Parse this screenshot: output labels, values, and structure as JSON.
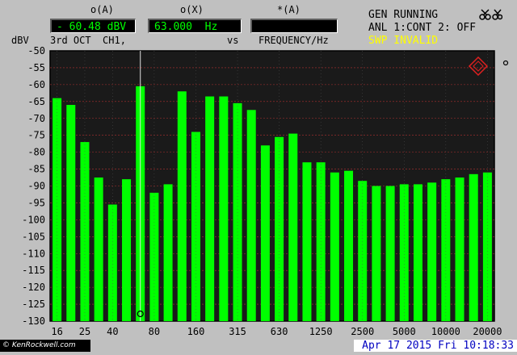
{
  "header": {
    "ch1_label": "o(A)",
    "ch1_value": "- 60.48 dBV",
    "ch2_label": "o(X)",
    "ch2_value": "63.000  Hz",
    "ch3_label": "*(A)",
    "ch3_value": ""
  },
  "left_info": {
    "y_unit": "dBV",
    "trace": "3rd OCT  CH1,",
    "vs": "vs",
    "x_unit": "FREQUENCY/Hz"
  },
  "status": {
    "line1": "GEN RUNNING",
    "line2": "ANL 1:CONT 2: OFF",
    "line3": "SWP INVALID",
    "line3_color": "#ffff00"
  },
  "icons": {
    "top_right": "scissors-icon",
    "brand": "rs-diamond-logo",
    "marker": "marker-circle",
    "scroll": "scroll-dot"
  },
  "footer": {
    "watermark": "© KenRockwell.com",
    "datetime": "Apr 17 2015 Fri 10:18:33"
  },
  "colors": {
    "plot_bg": "#1a1a1a",
    "bar": "#00ff00",
    "grid_h": "#b03030",
    "grid_v": "#505050",
    "cursor": "#e0e0e0"
  },
  "chart_data": {
    "type": "bar",
    "ylabel": "dBV",
    "xlabel": "FREQUENCY/Hz",
    "ylim": [
      -130,
      -50
    ],
    "y_ticks": [
      -50,
      -55,
      -60,
      -65,
      -70,
      -75,
      -80,
      -85,
      -90,
      -95,
      -100,
      -105,
      -110,
      -115,
      -120,
      -125,
      -130
    ],
    "x_tick_labels": [
      "16",
      "25",
      "40",
      "80",
      "160",
      "315",
      "630",
      "1250",
      "2500",
      "5000",
      "10000",
      "20000"
    ],
    "bands": [
      "16",
      "20",
      "25",
      "31.5",
      "40",
      "50",
      "63",
      "80",
      "100",
      "125",
      "160",
      "200",
      "250",
      "315",
      "400",
      "500",
      "630",
      "800",
      "1000",
      "1250",
      "1600",
      "2000",
      "2500",
      "3150",
      "4000",
      "5000",
      "6300",
      "8000",
      "10000",
      "12500",
      "16000",
      "20000"
    ],
    "values": [
      -64,
      -66,
      -77,
      -87.5,
      -95.5,
      -88,
      -60.48,
      -92,
      -89.5,
      -62,
      -74,
      -63.5,
      -63.5,
      -65.5,
      -67.5,
      -78,
      -75.5,
      -74.5,
      -83,
      -83,
      -86,
      -85.5,
      -88.5,
      -90,
      -90,
      -89.5,
      -89.5,
      -89,
      -88,
      -87.5,
      -86.5,
      -86
    ],
    "cursor_band": "63",
    "grid": true,
    "legend": "none"
  }
}
